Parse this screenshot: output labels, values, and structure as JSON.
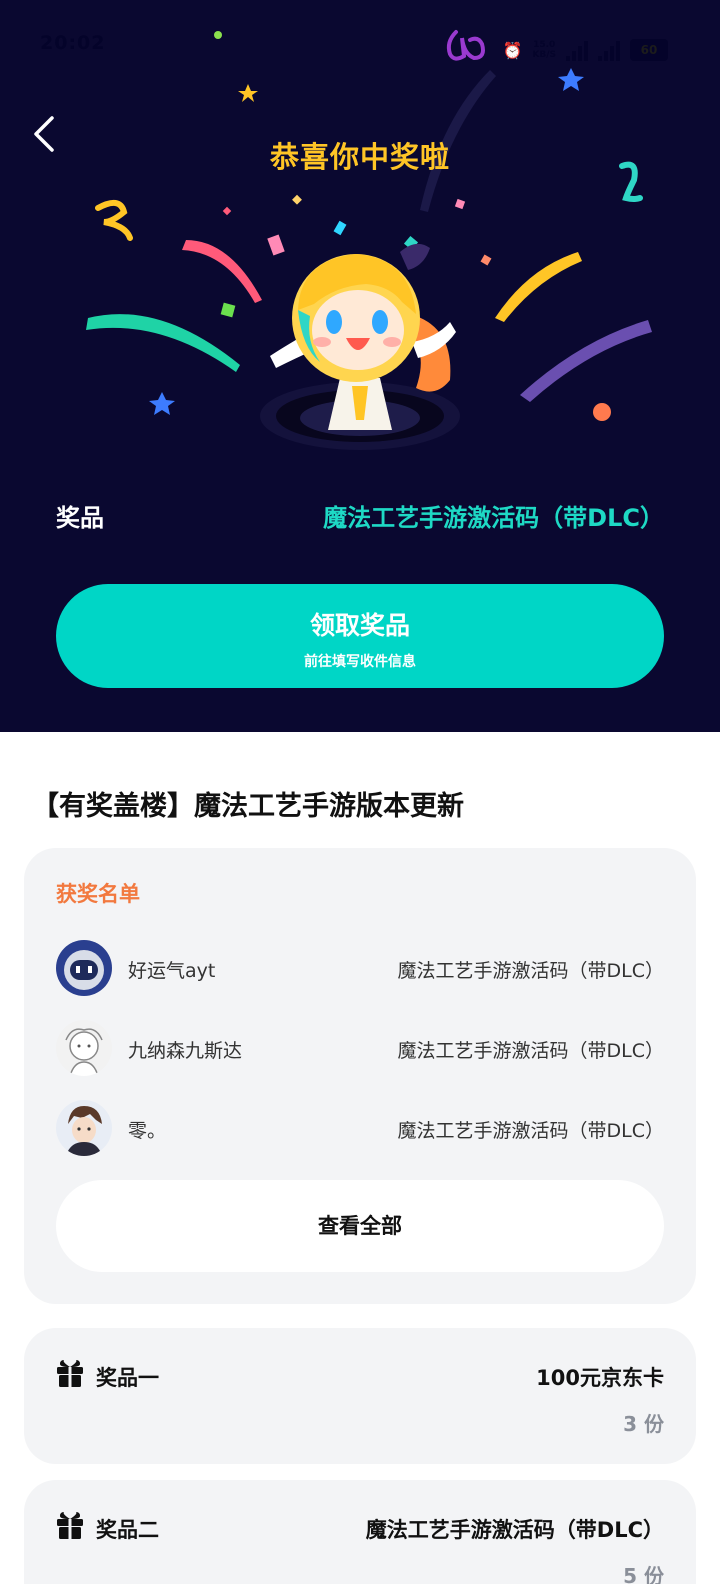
{
  "status_bar": {
    "time": "20:02",
    "speed_top": "15.0",
    "speed_bottom": "KB/S",
    "network_1": "5G",
    "network_2": "5G",
    "battery": "60"
  },
  "hero": {
    "title": "恭喜你中奖啦",
    "prize_label": "奖品",
    "prize_value": "魔法工艺手游激活码（带DLC）",
    "claim_button": {
      "label": "领取奖品",
      "sublabel": "前往填写收件信息"
    }
  },
  "post": {
    "title": "【有奖盖楼】魔法工艺手游版本更新"
  },
  "winners": {
    "title": "获奖名单",
    "list": [
      {
        "name": "好运气ayt",
        "prize": "魔法工艺手游激活码（带DLC）"
      },
      {
        "name": "九纳森九斯达",
        "prize": "魔法工艺手游激活码（带DLC）"
      },
      {
        "name": "零。",
        "prize": "魔法工艺手游激活码（带DLC）"
      }
    ],
    "view_all": "查看全部"
  },
  "prizes": [
    {
      "name": "奖品一",
      "item": "100元京东卡",
      "quantity": "3 份"
    },
    {
      "name": "奖品二",
      "item": "魔法工艺手游激活码（带DLC）",
      "quantity": "5 份"
    }
  ],
  "colors": {
    "hero_bg": "#0a0830",
    "accent_teal": "#00d6c6",
    "title_gold": "#ffc526",
    "winners_orange": "#f2793f"
  }
}
